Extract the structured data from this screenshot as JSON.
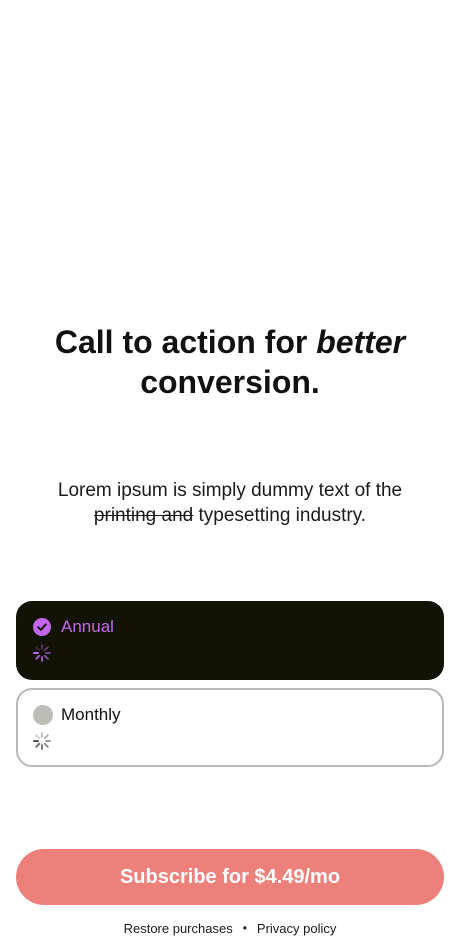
{
  "headline": {
    "line1_prefix": "Call to action for ",
    "line1_emphasis": "better",
    "line2": "conversion."
  },
  "body": {
    "line1": "Lorem ipsum is simply dummy text of the",
    "line2_struck": "printing and",
    "line2_rest": " typesetting industry."
  },
  "plans": [
    {
      "label": "Annual",
      "selected": true,
      "icon": "checkmark-circle-icon",
      "loading_icon": "loading-spinner-icon"
    },
    {
      "label": "Monthly",
      "selected": false,
      "icon": "radio-circle-icon",
      "loading_icon": "loading-spinner-icon"
    }
  ],
  "cta": {
    "label": "Subscribe for $4.49/mo"
  },
  "footer": {
    "restore_label": "Restore purchases",
    "separator": "•",
    "privacy_label": "Privacy policy"
  },
  "colors": {
    "accent": "#c266f2",
    "selected_card_bg": "#121303",
    "cta_bg": "#ee807c",
    "unselected_border": "#b8b8b8"
  }
}
